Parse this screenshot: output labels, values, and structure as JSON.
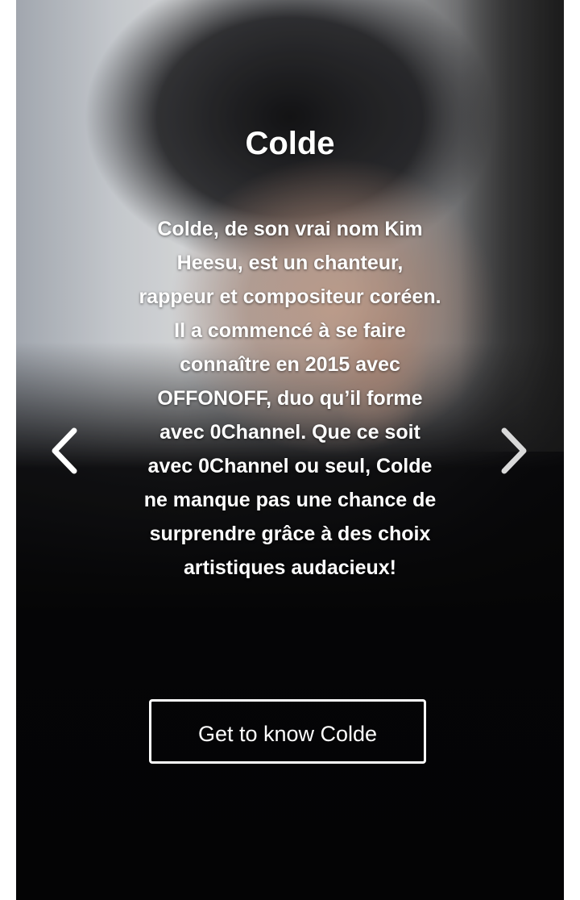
{
  "slide": {
    "title": "Colde",
    "description": "Colde, de son vrai nom Kim Heesu, est un chanteur, rappeur et compositeur coréen. Il a commencé à se faire connaître en 2015 avec OFFONOFF, duo qu’il forme avec 0Channel. Que ce soit avec 0Channel ou seul, Colde ne manque pas une chance de surprendre grâce à des choix artistiques audacieux!",
    "cta_label": "Get to know Colde"
  },
  "icons": {
    "prev": "chevron-left-icon",
    "next": "chevron-right-icon"
  },
  "colors": {
    "text": "#ffffff",
    "background": "#090909"
  }
}
